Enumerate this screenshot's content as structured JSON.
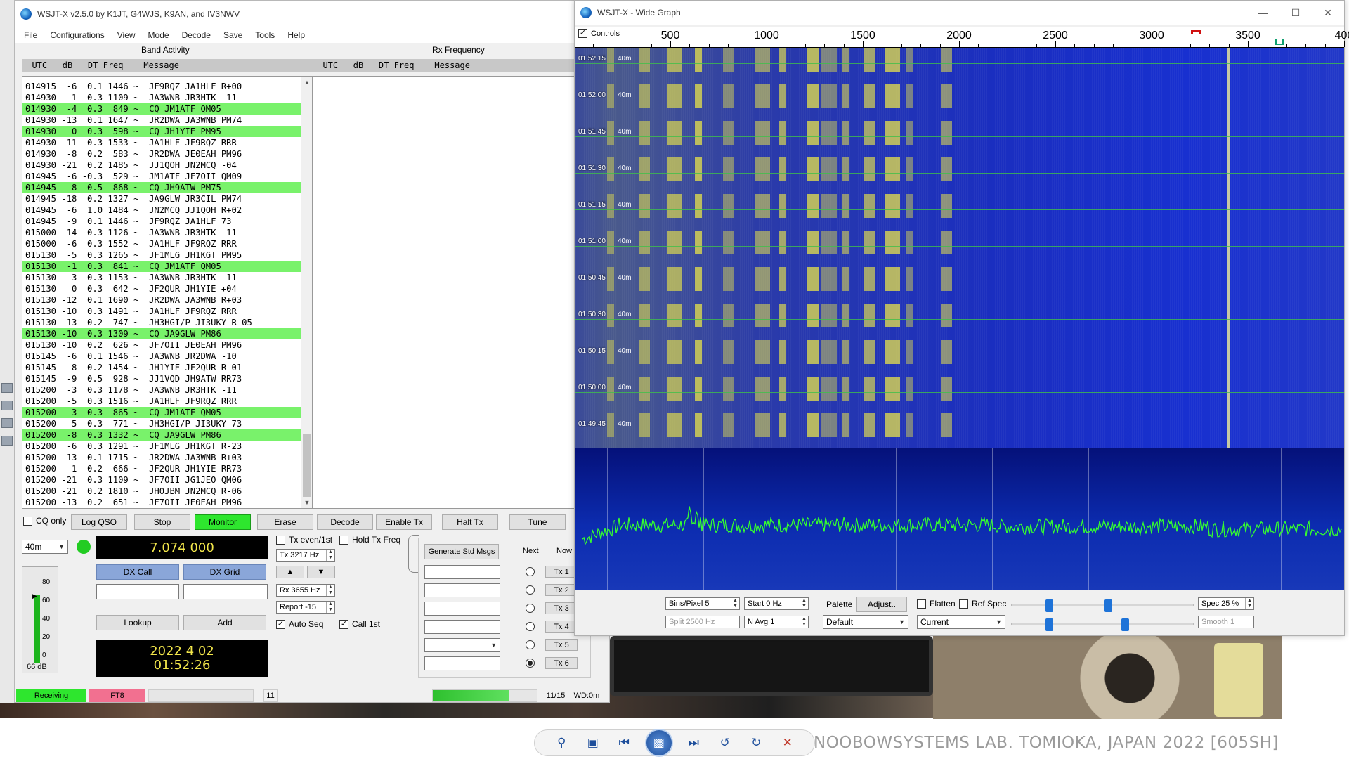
{
  "main_window": {
    "title": "WSJT-X   v2.5.0   by K1JT, G4WJS, K9AN, and IV3NWV",
    "menu": [
      "File",
      "Configurations",
      "View",
      "Mode",
      "Decode",
      "Save",
      "Tools",
      "Help"
    ],
    "band_activity_label": "Band Activity",
    "rx_frequency_label": "Rx Frequency",
    "list_header": "  UTC   dB   DT Freq    Message",
    "rx_header": "  UTC   dB   DT Freq    Message",
    "band_rows": [
      {
        "text": "014915  -6  0.1 1446 ~  JF9RQZ JA1HLF R+00",
        "cq": false
      },
      {
        "text": "014930  -1  0.3 1109 ~  JA3WNB JR3HTK -11",
        "cq": false
      },
      {
        "text": "014930  -4  0.3  849 ~  CQ JM1ATF QM05",
        "cq": true
      },
      {
        "text": "014930 -13  0.1 1647 ~  JR2DWA JA3WNB PM74",
        "cq": false
      },
      {
        "text": "014930   0  0.3  598 ~  CQ JH1YIE PM95",
        "cq": true
      },
      {
        "text": "014930 -11  0.3 1533 ~  JA1HLF JF9RQZ RRR",
        "cq": false
      },
      {
        "text": "014930  -8  0.2  583 ~  JR2DWA JE0EAH PM96",
        "cq": false
      },
      {
        "text": "014930 -21  0.2 1485 ~  JJ1QOH JN2MCQ -04",
        "cq": false
      },
      {
        "text": "014945  -6 -0.3  529 ~  JM1ATF JF7OII QM09",
        "cq": false
      },
      {
        "text": "014945  -8  0.5  868 ~  CQ JH9ATW PM75",
        "cq": true
      },
      {
        "text": "014945 -18  0.2 1327 ~  JA9GLW JR3CIL PM74",
        "cq": false
      },
      {
        "text": "014945  -6  1.0 1484 ~  JN2MCQ JJ1QOH R+02",
        "cq": false
      },
      {
        "text": "014945  -9  0.1 1446 ~  JF9RQZ JA1HLF 73",
        "cq": false
      },
      {
        "text": "015000 -14  0.3 1126 ~  JA3WNB JR3HTK -11",
        "cq": false
      },
      {
        "text": "015000  -6  0.3 1552 ~  JA1HLF JF9RQZ RRR",
        "cq": false
      },
      {
        "text": "015130  -5  0.3 1265 ~  JF1MLG JH1KGT PM95",
        "cq": false
      },
      {
        "text": "015130  -1  0.3  841 ~  CQ JM1ATF QM05",
        "cq": true
      },
      {
        "text": "015130  -3  0.3 1153 ~  JA3WNB JR3HTK -11",
        "cq": false
      },
      {
        "text": "015130   0  0.3  642 ~  JF2QUR JH1YIE +04",
        "cq": false
      },
      {
        "text": "015130 -12  0.1 1690 ~  JR2DWA JA3WNB R+03",
        "cq": false
      },
      {
        "text": "015130 -10  0.3 1491 ~  JA1HLF JF9RQZ RRR",
        "cq": false
      },
      {
        "text": "015130 -13  0.2  747 ~  JH3HGI/P JI3UKY R-05",
        "cq": false
      },
      {
        "text": "015130 -10  0.3 1309 ~  CQ JA9GLW PM86",
        "cq": true
      },
      {
        "text": "015130 -10  0.2  626 ~  JF7OII JE0EAH PM96",
        "cq": false
      },
      {
        "text": "015145  -6  0.1 1546 ~  JA3WNB JR2DWA -10",
        "cq": false
      },
      {
        "text": "015145  -8  0.2 1454 ~  JH1YIE JF2QUR R-01",
        "cq": false
      },
      {
        "text": "015145  -9  0.5  928 ~  JJ1VQD JH9ATW RR73",
        "cq": false
      },
      {
        "text": "015200  -3  0.3 1178 ~  JA3WNB JR3HTK -11",
        "cq": false
      },
      {
        "text": "015200  -5  0.3 1516 ~  JA1HLF JF9RQZ RRR",
        "cq": false
      },
      {
        "text": "015200  -3  0.3  865 ~  CQ JM1ATF QM05",
        "cq": true
      },
      {
        "text": "015200  -5  0.3  771 ~  JH3HGI/P JI3UKY 73",
        "cq": false
      },
      {
        "text": "015200  -8  0.3 1332 ~  CQ JA9GLW PM86",
        "cq": true
      },
      {
        "text": "015200  -6  0.3 1291 ~  JF1MLG JH1KGT R-23",
        "cq": false
      },
      {
        "text": "015200 -13  0.1 1715 ~  JR2DWA JA3WNB R+03",
        "cq": false
      },
      {
        "text": "015200  -1  0.2  666 ~  JF2QUR JH1YIE RR73",
        "cq": false
      },
      {
        "text": "015200 -21  0.3 1109 ~  JF7OII JG1JEO QM06",
        "cq": false
      },
      {
        "text": "015200 -21  0.2 1810 ~  JH0JBM JN2MCQ R-06",
        "cq": false
      },
      {
        "text": "015200 -13  0.2  651 ~  JF7OII JE0EAH PM96",
        "cq": false
      }
    ],
    "buttons": {
      "cq_only": "CQ only",
      "log_qso": "Log QSO",
      "stop": "Stop",
      "monitor": "Monitor",
      "erase": "Erase",
      "decode": "Decode",
      "enable_tx": "Enable Tx",
      "halt_tx": "Halt Tx",
      "tune": "Tune",
      "dx_call": "DX Call",
      "dx_grid": "DX Grid",
      "lookup": "Lookup",
      "add": "Add",
      "generate_std_msgs": "Generate Std Msgs"
    },
    "band_select": "40m",
    "frequency_display": "7.074 000",
    "tx_even": "Tx even/1st",
    "hold_tx_freq": "Hold Tx Freq",
    "tx_freq": "Tx  3217  Hz",
    "rx_freq": "Rx  3655  Hz",
    "report": "Report -15",
    "auto_seq": "Auto Seq",
    "call_1st": "Call 1st",
    "date_display": "2022 4 02",
    "time_display": "01:52:26",
    "meter_labels": [
      "80",
      "60",
      "40",
      "20",
      "0"
    ],
    "meter_db": "66 dB",
    "next_label": "Next",
    "now_label": "Now",
    "tx_buttons": [
      "Tx 1",
      "Tx 2",
      "Tx 3",
      "Tx 4",
      "Tx 5",
      "Tx 6"
    ],
    "status": {
      "receiving": "Receiving",
      "mode": "FT8",
      "count": "11",
      "progress_text": "11/15",
      "progress_fraction": 0.73,
      "wd": "WD:0m"
    }
  },
  "wide_graph": {
    "title": "WSJT-X - Wide Graph",
    "controls_label": "Controls",
    "freq_ticks": [
      "500",
      "1000",
      "1500",
      "2000",
      "2500",
      "3000",
      "3500",
      "400"
    ],
    "time_labels": [
      "01:52:15",
      "01:52:00",
      "01:51:45",
      "01:51:30",
      "01:51:15",
      "01:51:00",
      "01:50:45",
      "01:50:30",
      "01:50:15",
      "01:50:00",
      "01:49:45"
    ],
    "band_label": "40m",
    "bins_pixel": "Bins/Pixel  5",
    "start": "Start 0 Hz",
    "palette_label": "Palette",
    "adjust": "Adjust..",
    "flatten": "Flatten",
    "ref_spec": "Ref Spec",
    "spec": "Spec 25 %",
    "split": "Split  2500  Hz",
    "n_avg": "N Avg 1",
    "palette_value": "Default",
    "current_value": "Current",
    "smooth": "Smooth   1"
  },
  "watermark": "NOOBOWSYSTEMS LAB. TOMIOKA, JAPAN 2022 [605SH]",
  "colors": {
    "cq_highlight": "#79f26b",
    "monitor_on": "#2ee62e",
    "waterfall_blue": "#1a2ec0",
    "signal_yellow": "#e7e24a",
    "spectrum_green": "#35ff2e"
  }
}
